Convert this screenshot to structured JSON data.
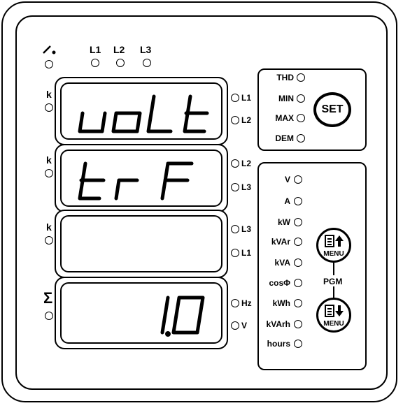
{
  "top_indicators": {
    "breaker_icon": "switch-open-icon",
    "phases": [
      "L1",
      "L2",
      "L3"
    ]
  },
  "rows": [
    {
      "prefix": "k",
      "text": "uoLt",
      "right_labels": [
        "L1",
        "L2"
      ]
    },
    {
      "prefix": "k",
      "text": "trF",
      "right_labels": [
        "L2",
        "L3"
      ]
    },
    {
      "prefix": "k",
      "text": "",
      "right_labels": [
        "L3",
        "L1"
      ]
    },
    {
      "prefix": "Σ",
      "text": "1.0",
      "right_labels": [
        "Hz",
        "V"
      ]
    }
  ],
  "mode_panel": {
    "items": [
      "THD",
      "MIN",
      "MAX",
      "DEM"
    ],
    "set_button": "SET"
  },
  "unit_panel": {
    "items": [
      "V",
      "A",
      "kW",
      "kVAr",
      "kVA",
      "cosΦ",
      "kWh",
      "kVArh",
      "hours"
    ],
    "menu_up_label": "MENU",
    "menu_down_label": "MENU",
    "pgm_label": "PGM"
  }
}
